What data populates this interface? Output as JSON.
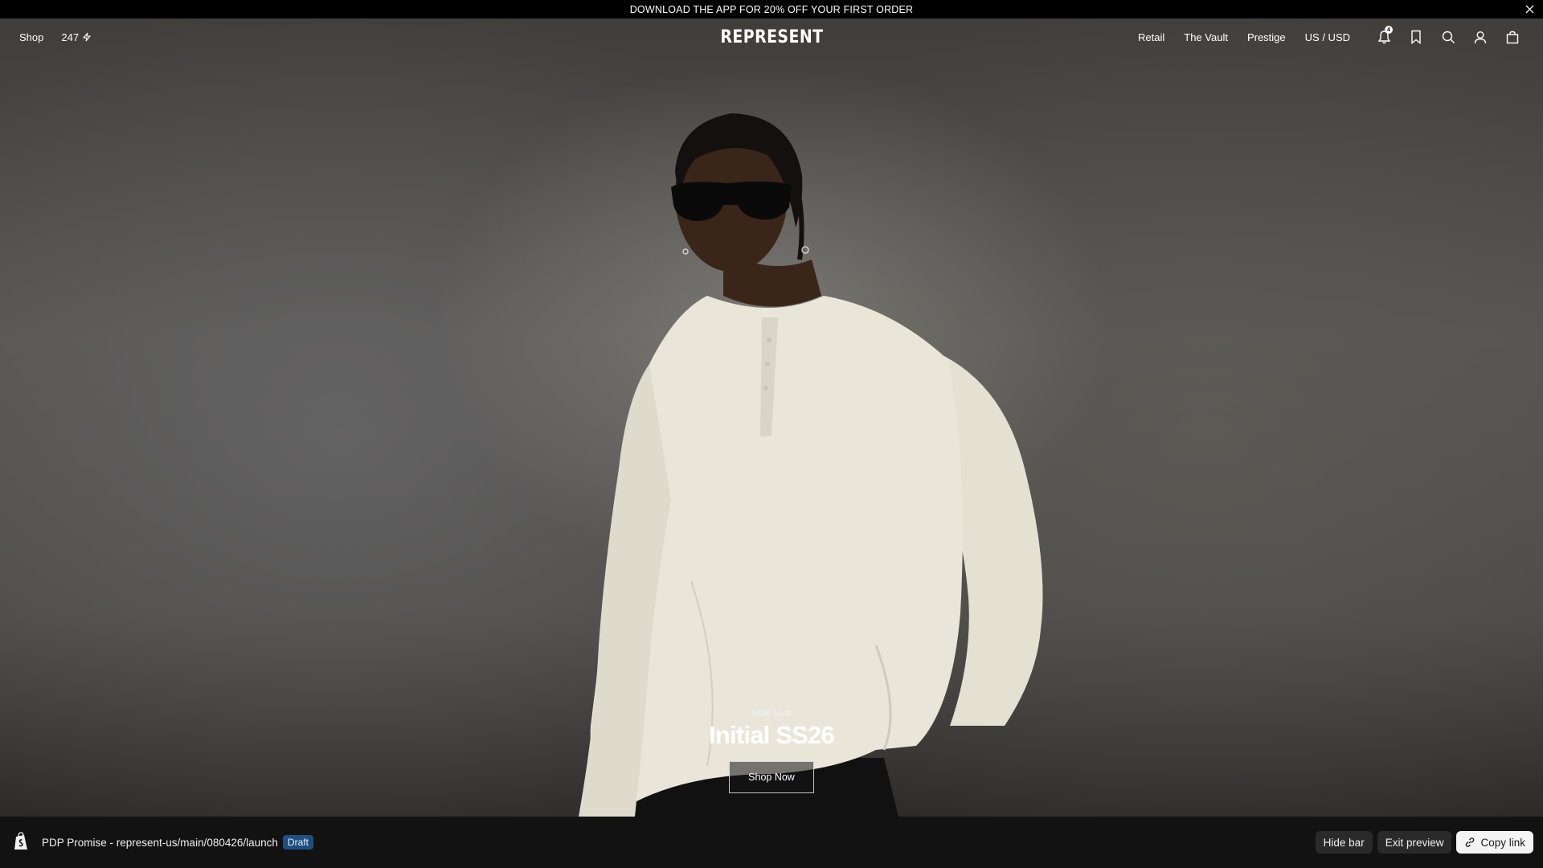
{
  "announcement": {
    "text": "DOWNLOAD THE APP FOR 20% OFF YOUR FIRST ORDER",
    "close_icon": "close-icon"
  },
  "header": {
    "left_nav": {
      "shop": "Shop",
      "counter": "247",
      "counter_icon": "bolt-icon"
    },
    "logo": "REPRESENT",
    "right_nav": [
      "Retail",
      "The Vault",
      "Prestige",
      "US / USD"
    ],
    "notifications_badge": "4",
    "icons": [
      "bell-icon",
      "bookmark-icon",
      "search-icon",
      "account-icon",
      "bag-icon"
    ]
  },
  "hero": {
    "eyebrow": "Now Live",
    "headline": "Initial SS26",
    "cta": "Shop Now",
    "image": "model in cream waffle-knit henley and dark sunglasses against grey backdrop"
  },
  "preview_bar": {
    "path": "PDP Promise - represent-us/main/080426/launch",
    "status": "Draft",
    "hide_bar": "Hide bar",
    "exit_preview": "Exit preview",
    "copy_link": "Copy link"
  },
  "colors": {
    "announcement_bg": "#000000",
    "preview_bar_bg": "#121212",
    "draft_badge": "#1f4f80",
    "accent": "#ffffff"
  }
}
